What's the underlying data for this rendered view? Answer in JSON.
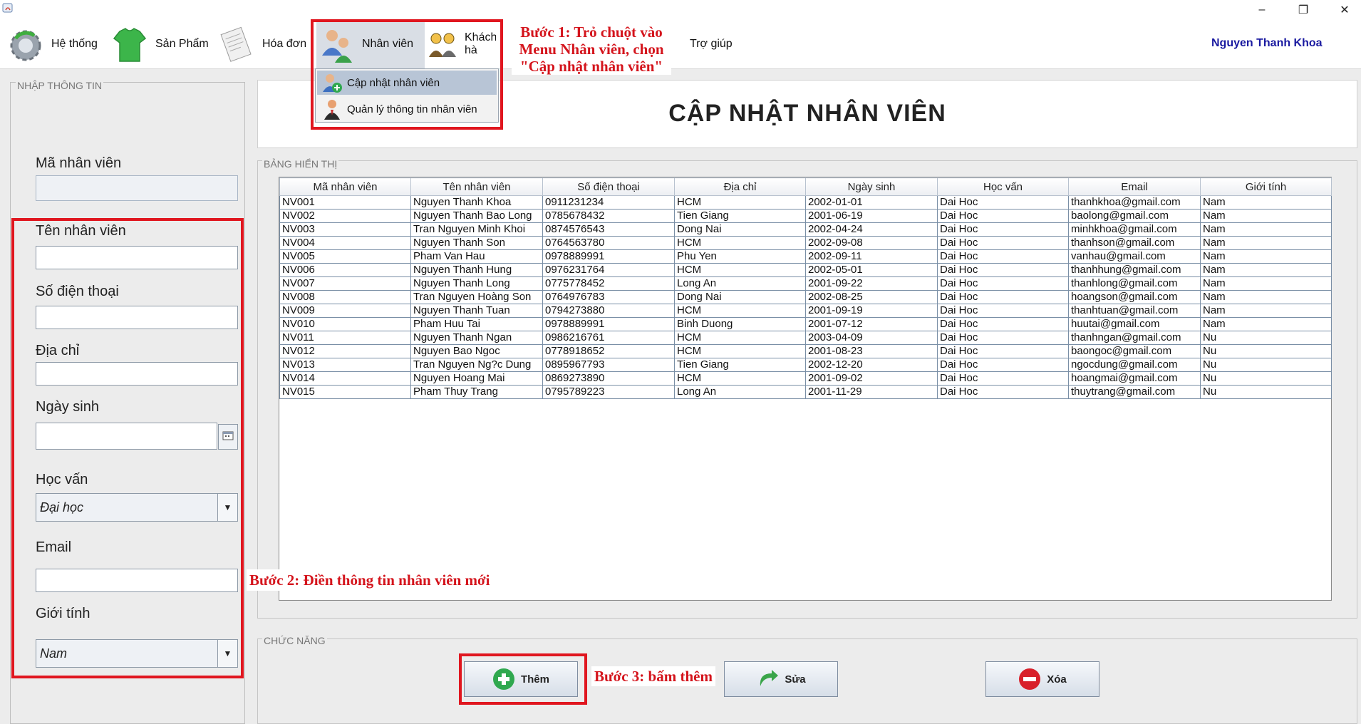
{
  "window": {
    "minimize_label": "–",
    "restore_label": "❐",
    "close_label": "✕"
  },
  "menu": {
    "items": [
      {
        "label": "Hệ thống",
        "icon": "gear-icon"
      },
      {
        "label": "Sản Phẩm",
        "icon": "tshirt-icon"
      },
      {
        "label": "Hóa đơn",
        "icon": "invoice-icon"
      },
      {
        "label": "Nhân viên",
        "icon": "employees-icon"
      },
      {
        "label": "Khách hà",
        "icon": "customers-icon"
      },
      {
        "label": "Trợ giúp",
        "icon": "help-globe-icon"
      }
    ],
    "user_name": "Nguyen Thanh Khoa"
  },
  "dropdown": {
    "items": [
      {
        "label": "Cập nhật nhân viên",
        "icon": "add-employee-icon"
      },
      {
        "label": "Quản lý thông tin nhân viên",
        "icon": "manage-employee-icon"
      }
    ]
  },
  "annotations": {
    "step1": [
      "Bước 1: Trỏ chuột vào",
      "Menu Nhân viên, chọn",
      "\"Cập nhật nhân viên\""
    ],
    "step2": "Bước 2: Điền thông tin nhân viên mới",
    "step3": "Bước 3: bấm thêm"
  },
  "form": {
    "group_title": "NHẬP THÔNG TIN",
    "ma_label": "Mã nhân viên",
    "ten_label": "Tên nhân viên",
    "sdt_label": "Số điện thoại",
    "diachi_label": "Địa chỉ",
    "ngaysinh_label": "Ngày sinh",
    "hocvan_label": "Học vấn",
    "hocvan_value": "Đại học",
    "email_label": "Email",
    "gioitinh_label": "Giới tính",
    "gioitinh_value": "Nam"
  },
  "page_title": "CẬP NHẬT NHÂN VIÊN",
  "table": {
    "group_title": "BẢNG HIỂN THỊ",
    "columns": [
      "Mã nhân viên",
      "Tên nhân viên",
      "Số điện thoại",
      "Địa chỉ",
      "Ngày sinh",
      "Học vấn",
      "Email",
      "Giới tính"
    ],
    "rows": [
      [
        "NV001",
        "Nguyen Thanh Khoa",
        "0911231234",
        "HCM",
        "2002-01-01",
        "Dai Hoc",
        "thanhkhoa@gmail.com",
        "Nam"
      ],
      [
        "NV002",
        "Nguyen Thanh Bao Long",
        "0785678432",
        "Tien Giang",
        "2001-06-19",
        "Dai Hoc",
        "baolong@gmail.com",
        "Nam"
      ],
      [
        "NV003",
        "Tran Nguyen Minh Khoi",
        "0874576543",
        "Dong Nai",
        "2002-04-24",
        "Dai Hoc",
        "minhkhoa@gmail.com",
        "Nam"
      ],
      [
        "NV004",
        "Nguyen Thanh Son",
        "0764563780",
        "HCM",
        "2002-09-08",
        "Dai Hoc",
        "thanhson@gmail.com",
        "Nam"
      ],
      [
        "NV005",
        "Pham Van Hau",
        "0978889991",
        "Phu Yen",
        "2002-09-11",
        "Dai Hoc",
        "vanhau@gmail.com",
        "Nam"
      ],
      [
        "NV006",
        "Nguyen Thanh Hung",
        "0976231764",
        "HCM",
        "2002-05-01",
        "Dai Hoc",
        "thanhhung@gmail.com",
        "Nam"
      ],
      [
        "NV007",
        "Nguyen Thanh Long",
        "0775778452",
        "Long An",
        "2001-09-22",
        "Dai Hoc",
        "thanhlong@gmail.com",
        "Nam"
      ],
      [
        "NV008",
        "Tran Nguyen Hoàng Son",
        "0764976783",
        "Dong Nai",
        "2002-08-25",
        "Dai Hoc",
        "hoangson@gmail.com",
        "Nam"
      ],
      [
        "NV009",
        "Nguyen Thanh Tuan",
        "0794273880",
        "HCM",
        "2001-09-19",
        "Dai Hoc",
        "thanhtuan@gmail.com",
        "Nam"
      ],
      [
        "NV010",
        "Pham Huu Tai",
        "0978889991",
        "Binh Duong",
        "2001-07-12",
        "Dai Hoc",
        "huutai@gmail.com",
        "Nam"
      ],
      [
        "NV011",
        "Nguyen Thanh Ngan",
        "0986216761",
        "HCM",
        "2003-04-09",
        "Dai Hoc",
        "thanhngan@gmail.com",
        "Nu"
      ],
      [
        "NV012",
        "Nguyen Bao Ngoc",
        "0778918652",
        "HCM",
        "2001-08-23",
        "Dai Hoc",
        "baongoc@gmail.com",
        "Nu"
      ],
      [
        "NV013",
        "Tran Nguyen Ng?c Dung",
        "0895967793",
        "Tien Giang",
        "2002-12-20",
        "Dai Hoc",
        "ngocdung@gmail.com",
        "Nu"
      ],
      [
        "NV014",
        "Nguyen Hoang Mai",
        "0869273890",
        "HCM",
        "2001-09-02",
        "Dai Hoc",
        "hoangmai@gmail.com",
        "Nu"
      ],
      [
        "NV015",
        "Pham Thuy Trang",
        "0795789223",
        "Long An",
        "2001-11-29",
        "Dai Hoc",
        "thuytrang@gmail.com",
        "Nu"
      ]
    ]
  },
  "functions": {
    "group_title": "CHỨC NĂNG",
    "add_label": "Thêm",
    "edit_label": "Sửa",
    "delete_label": "Xóa"
  }
}
